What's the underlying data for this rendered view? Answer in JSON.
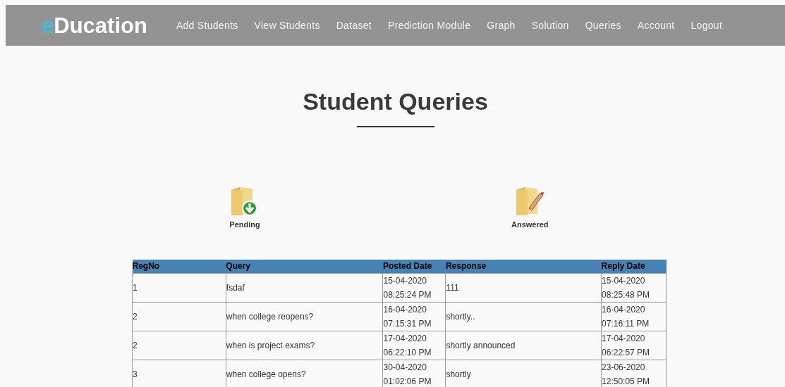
{
  "logo": {
    "accent": "e",
    "rest": "Ducation"
  },
  "nav": [
    "Add Students",
    "View Students",
    "Dataset",
    "Prediction Module",
    "Graph",
    "Solution",
    "Queries",
    "Account",
    "Logout"
  ],
  "heading": "Student Queries",
  "folders": [
    {
      "kind": "pending",
      "label": "Pending"
    },
    {
      "kind": "answered",
      "label": "Answered"
    }
  ],
  "table": {
    "columns": [
      "RegNo",
      "Query",
      "Posted Date",
      "Response",
      "Reply Date"
    ],
    "rows": [
      {
        "regno": "1",
        "query": "fsdaf",
        "posted": [
          "15-04-2020",
          "08:25:24 PM"
        ],
        "response": "111",
        "reply": [
          "15-04-2020",
          "08:25:48 PM"
        ]
      },
      {
        "regno": "2",
        "query": "when college reopens?",
        "posted": [
          "16-04-2020",
          "07:15:31 PM"
        ],
        "response": "shortly..",
        "reply": [
          "16-04-2020",
          "07:16:11 PM"
        ]
      },
      {
        "regno": "2",
        "query": "when is project exams?",
        "posted": [
          "17-04-2020",
          "06:22:10 PM"
        ],
        "response": "shortly announced",
        "reply": [
          "17-04-2020",
          "06:22:57 PM"
        ]
      },
      {
        "regno": "3",
        "query": "when college opens?",
        "posted": [
          "30-04-2020",
          "01:02:06 PM"
        ],
        "response": "shortly",
        "reply": [
          "23-06-2020",
          "12:50:05 PM"
        ]
      }
    ]
  }
}
